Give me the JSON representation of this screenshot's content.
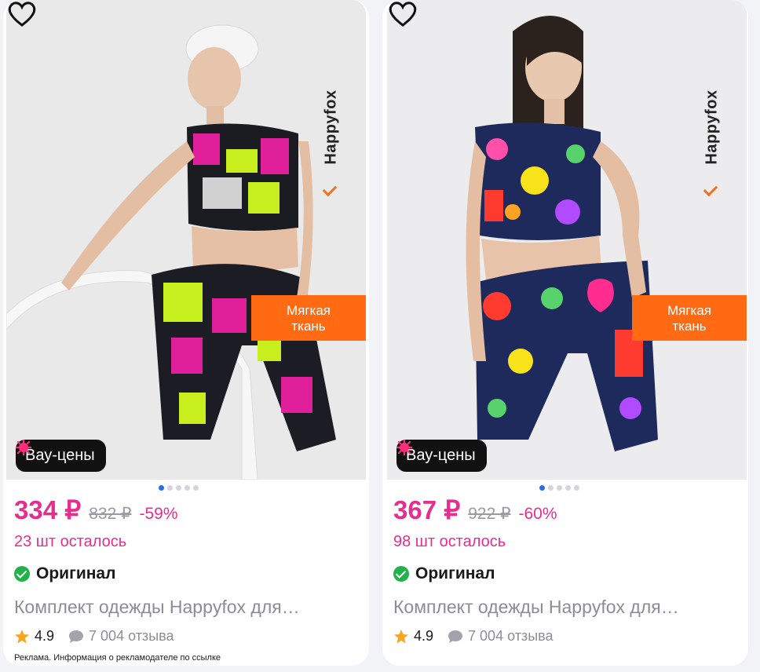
{
  "products": [
    {
      "brand": "Happyfox",
      "promo_label": "Мягкая ткань",
      "promo_line1": "Мягкая",
      "promo_line2": "ткань",
      "wow_label": "Вау-цены",
      "price": "334 ₽",
      "old_price": "832 ₽",
      "discount": "-59%",
      "stock": "23 шт осталось",
      "original_label": "Оригинал",
      "title": "Комплект одежды Happyfox для…",
      "rating": "4.9",
      "reviews": "7 004 отзыва",
      "carousel": {
        "total": 5,
        "active": 0
      }
    },
    {
      "brand": "Happyfox",
      "promo_label": "Мягкая ткань",
      "promo_line1": "Мягкая",
      "promo_line2": "ткань",
      "wow_label": "Вау-цены",
      "price": "367 ₽",
      "old_price": "922 ₽",
      "discount": "-60%",
      "stock": "98 шт осталось",
      "original_label": "Оригинал",
      "title": "Комплект одежды Happyfox для…",
      "rating": "4.9",
      "reviews": "7 004 отзыва",
      "carousel": {
        "total": 5,
        "active": 0
      }
    }
  ],
  "ad_disclaimer": "Реклама. Информация о рекламодателе по ссылке",
  "icons": {
    "favorite": "heart-outline-icon",
    "wow": "burst-icon",
    "original": "check-circle-icon",
    "rating": "star-icon",
    "reviews": "chat-bubble-icon"
  },
  "colors": {
    "accent": "#e62e8f",
    "promo": "#ff6a12",
    "verified": "#22b24c",
    "star": "#f5a623",
    "carousel_active": "#2e6be6"
  }
}
